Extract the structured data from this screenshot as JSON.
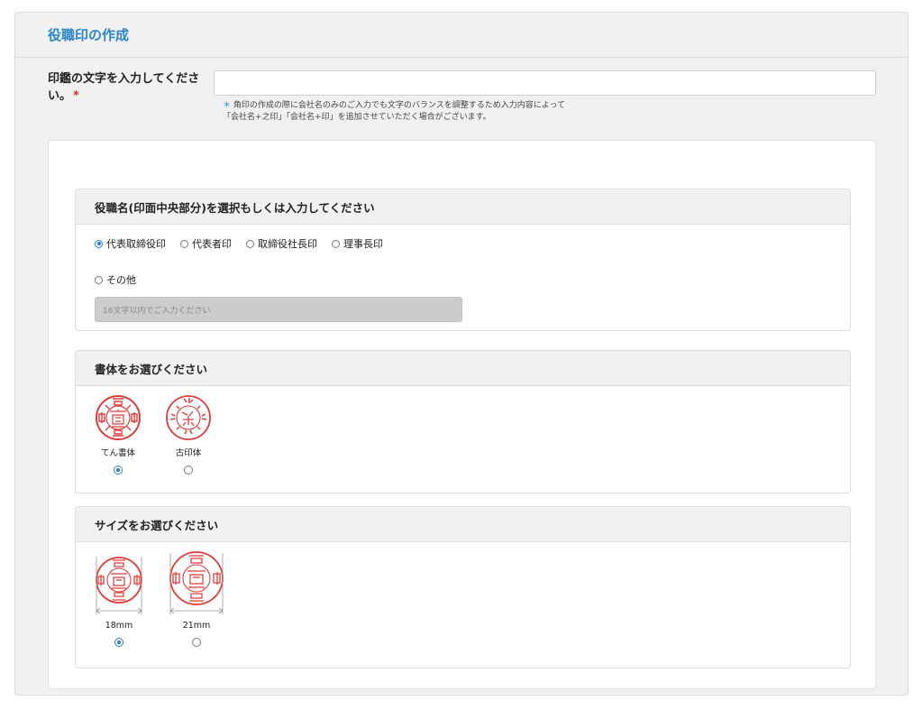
{
  "section": {
    "title": "役職印の作成"
  },
  "seal_text": {
    "label": "印鑑の文字を入力してください。",
    "required_mark": "*",
    "value": "",
    "note_mark": "＊",
    "note_line1": "角印の作成の際に会社名のみのご入力でも文字のバランスを調整するため入力内容によって",
    "note_line2": "「会社名+之印」「会社名+印」を追加させていただく場合がございます。"
  },
  "position": {
    "heading": "役職名(印面中央部分)を選択もしくは入力してください",
    "options": [
      {
        "label": "代表取締役印",
        "selected": true
      },
      {
        "label": "代表者印",
        "selected": false
      },
      {
        "label": "取締役社長印",
        "selected": false
      },
      {
        "label": "理事長印",
        "selected": false
      }
    ],
    "other_label": "その他",
    "other_placeholder": "16文字以内でご入力ください"
  },
  "font": {
    "heading": "書体をお選びください",
    "options": [
      {
        "label": "てん書体",
        "selected": true,
        "icon": "tensho-seal-sample"
      },
      {
        "label": "古印体",
        "selected": false,
        "icon": "koinn-seal-sample"
      }
    ]
  },
  "size": {
    "heading": "サイズをお選びください",
    "options": [
      {
        "label": "18mm",
        "selected": true,
        "icon": "seal-18mm-sample"
      },
      {
        "label": "21mm",
        "selected": false,
        "icon": "seal-21mm-sample"
      }
    ]
  },
  "colors": {
    "accent": "#2a86c9",
    "seal_red": "#e23b3b",
    "required": "#e0302c"
  }
}
